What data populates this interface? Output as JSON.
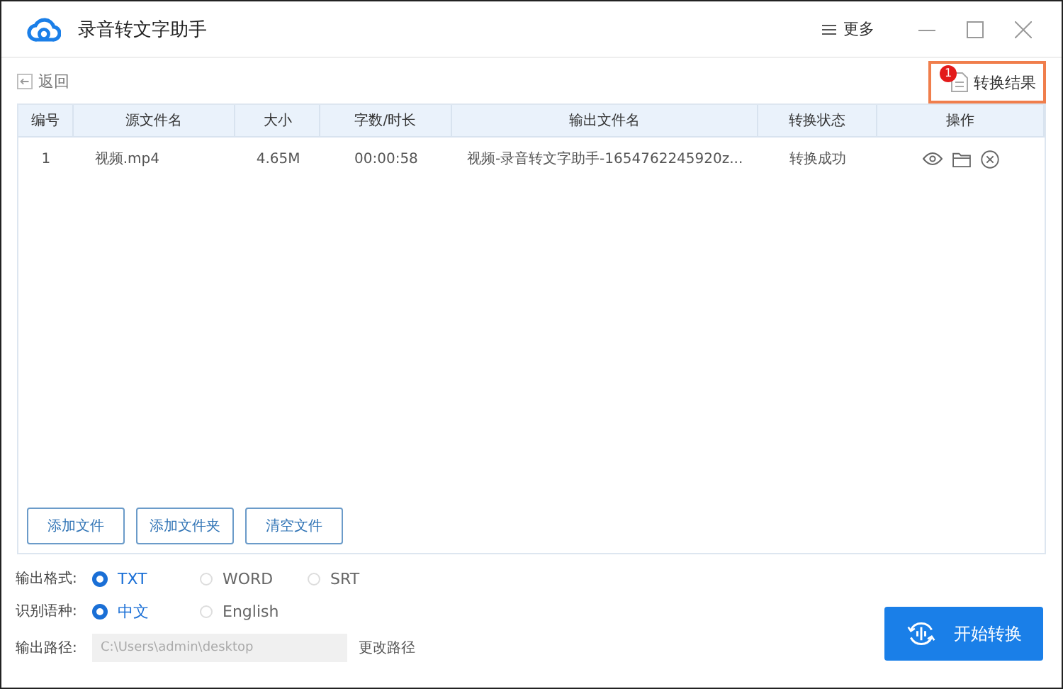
{
  "window": {
    "title": "录音转文字助手",
    "menu": "更多"
  },
  "back": "返回",
  "results": {
    "label": "转换结果",
    "badge": "1"
  },
  "table": {
    "columns": [
      "编号",
      "源文件名",
      "大小",
      "字数/时长",
      "输出文件名",
      "转换状态",
      "操作"
    ],
    "rows": [
      {
        "cells": [
          "1",
          "视频.mp4",
          "4.65M",
          "00:00:58",
          "视频-录音转文字助手-1654762245920z...",
          "转换成功"
        ]
      }
    ]
  },
  "file_buttons": [
    "添加文件",
    "添加文件夹",
    "清空文件"
  ],
  "options": [
    {
      "label": "输出格式:",
      "choices": [
        {
          "label": "TXT",
          "selected": true
        },
        {
          "label": "WORD",
          "selected": false
        },
        {
          "label": "SRT",
          "selected": false
        }
      ]
    },
    {
      "label": "识别语种:",
      "choices": [
        {
          "label": "中文",
          "selected": true
        },
        {
          "label": "English",
          "selected": false
        }
      ]
    }
  ],
  "output_path": {
    "label": "输出路径:",
    "value": "C:\\Users\\admin\\desktop",
    "change": "更改路径"
  },
  "start_button": "开始转换"
}
